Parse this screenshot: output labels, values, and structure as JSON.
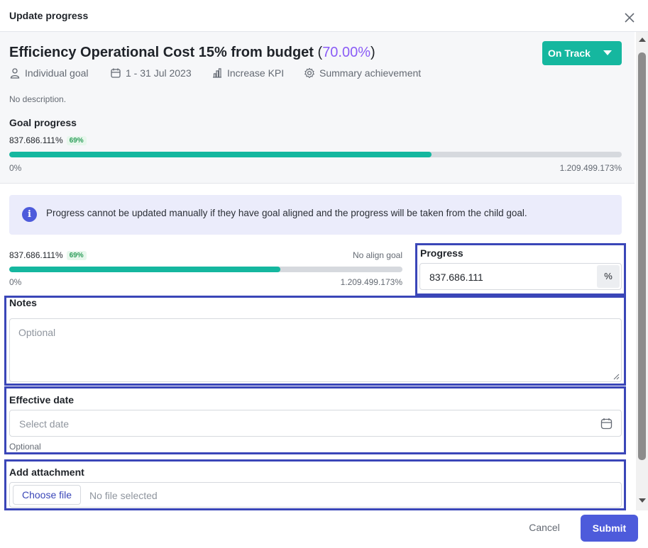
{
  "dialog": {
    "title": "Update progress"
  },
  "goal": {
    "title": "Efficiency Operational Cost 15% from budget",
    "percent_display": "70.00%",
    "status": "On Track",
    "meta": {
      "type": "Individual goal",
      "date_range": "1 - 31 Jul 2023",
      "kpi_mode": "Increase KPI",
      "achievement": "Summary achievement"
    },
    "description": "No description.",
    "progress_label": "Goal progress",
    "current_value": "837.686.111%",
    "badge": "69%",
    "min_label": "0%",
    "max_label": "1.209.499.173%",
    "fill_fraction": 0.69
  },
  "info": {
    "message": "Progress cannot be updated manually if they have goal aligned and the progress will be taken from the child goal."
  },
  "child": {
    "current_value": "837.686.111%",
    "badge": "69%",
    "align_label": "No align goal",
    "min_label": "0%",
    "max_label": "1.209.499.173%",
    "fill_fraction": 0.69
  },
  "form": {
    "progress_label": "Progress",
    "progress_value": "837.686.111",
    "progress_unit": "%",
    "notes_label": "Notes",
    "notes_placeholder": "Optional",
    "date_label": "Effective date",
    "date_placeholder": "Select date",
    "date_hint": "Optional",
    "attachment_label": "Add attachment",
    "choose_file": "Choose file",
    "no_file": "No file selected"
  },
  "footer": {
    "cancel": "Cancel",
    "submit": "Submit"
  },
  "colors": {
    "accent": "#4d5bdb",
    "success": "#15b79f",
    "highlight": "#3a46b8",
    "percent": "#8a5cf6"
  }
}
